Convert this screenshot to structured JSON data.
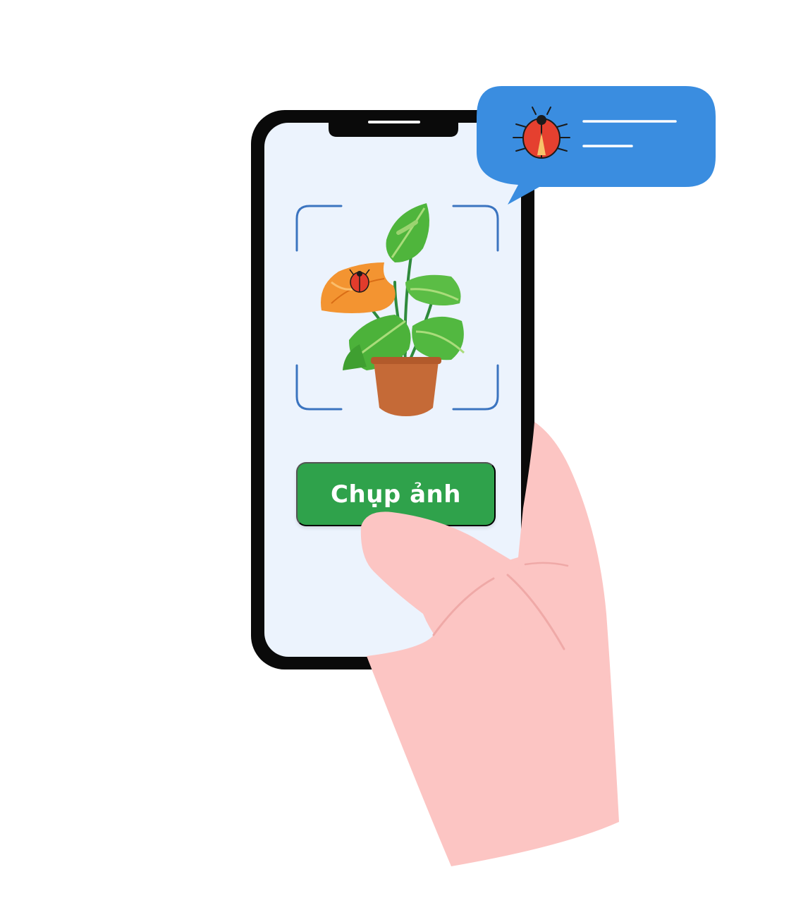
{
  "phone": {
    "capture_button_label": "Chụp ảnh"
  },
  "notification": {
    "icon": "ladybug-icon"
  },
  "scan_subject": {
    "plant_icon": "potted-plant-icon",
    "pest_icon": "ladybug-icon"
  },
  "colors": {
    "accent_blue": "#3a8de0",
    "button_green": "#2fa24b",
    "screen_bg": "#ecf3fd",
    "skin": "#fcc5c3"
  }
}
